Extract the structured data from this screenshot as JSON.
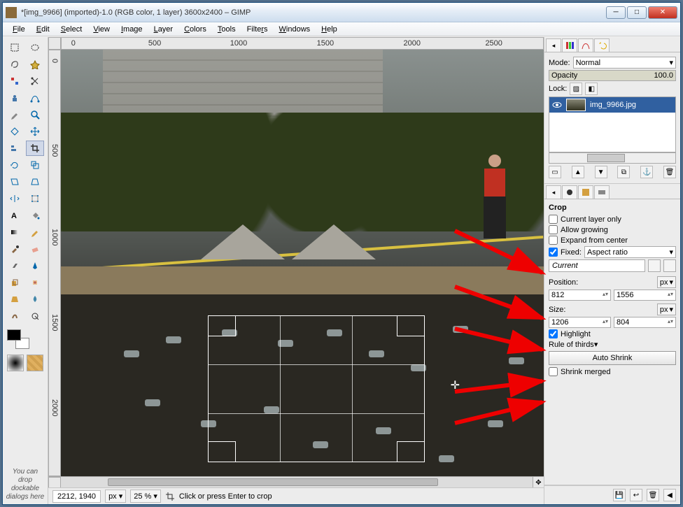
{
  "window": {
    "title": "*[img_9966] (imported)-1.0 (RGB color, 1 layer) 3600x2400 – GIMP"
  },
  "menu": {
    "items": [
      "File",
      "Edit",
      "Select",
      "View",
      "Image",
      "Layer",
      "Colors",
      "Tools",
      "Filters",
      "Windows",
      "Help"
    ]
  },
  "ruler_h": [
    "0",
    "500",
    "1000",
    "1500",
    "2000",
    "2500"
  ],
  "ruler_v": [
    "0",
    "500",
    "1000",
    "1500",
    "2000"
  ],
  "toolbox_hint": "You can drop dockable dialogs here",
  "status": {
    "coords": "2212, 1940",
    "unit": "px",
    "zoom": "25 %",
    "hint": "Click or press Enter to crop"
  },
  "layers": {
    "mode_label": "Mode:",
    "mode_value": "Normal",
    "opacity_label": "Opacity",
    "opacity_value": "100.0",
    "lock_label": "Lock:",
    "items": [
      {
        "name": "img_9966.jpg",
        "visible": true
      }
    ]
  },
  "tool_options": {
    "title": "Crop",
    "current_layer_only": {
      "label": "Current layer only",
      "checked": false
    },
    "allow_growing": {
      "label": "Allow growing",
      "checked": false
    },
    "expand_from_center": {
      "label": "Expand from center",
      "checked": false
    },
    "fixed": {
      "label": "Fixed:",
      "checked": true,
      "mode": "Aspect ratio",
      "value": "Current"
    },
    "position": {
      "label": "Position:",
      "unit": "px",
      "x": "812",
      "y": "1556"
    },
    "size": {
      "label": "Size:",
      "unit": "px",
      "w": "1206",
      "h": "804"
    },
    "highlight": {
      "label": "Highlight",
      "checked": true
    },
    "guides": "Rule of thirds",
    "auto_shrink": "Auto Shrink",
    "shrink_merged": {
      "label": "Shrink merged",
      "checked": false
    }
  }
}
